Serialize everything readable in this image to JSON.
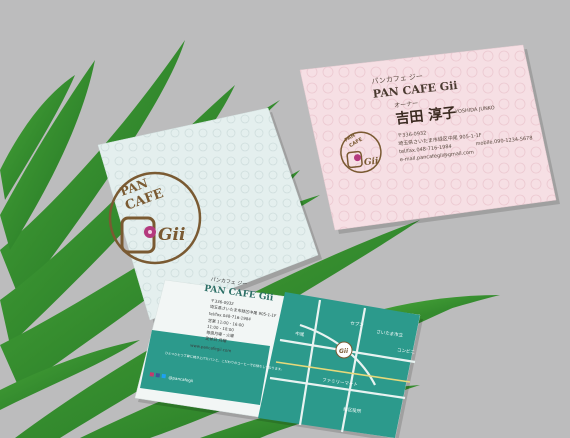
{
  "colors": {
    "background": "#bcbcbd",
    "leaf": "#2e8a2a",
    "card_mint": "#e4efee",
    "card_pink": "#f6dfe4",
    "teal": "#2c9a8c",
    "logo_brown": "#7a5a32",
    "flower": "#b43a7e"
  },
  "logo": {
    "line1": "PAN",
    "line2": "CAFE",
    "line3": "Gii"
  },
  "pink_card": {
    "kana": "パンカフェ ジー",
    "shop_name": "PAN CAFE Gii",
    "role": "オーナー",
    "person_name": "吉田 淳子",
    "person_romaji": "YOSHIDA JUNKO",
    "address_1": "〒336-0932",
    "address_2": "埼玉県さいたま市緑区中尾 905-1-1F",
    "tel": "tel/fax.048-716-1984",
    "mobile": "mobile.090-1234-5678",
    "email": "e-mail.pancafegii@gmail.com"
  },
  "back_card": {
    "kana": "パンカフェ ジー",
    "shop_name": "PAN CAFE Gii",
    "address_1": "〒336-0932",
    "address_2": "埼玉県さいたま市緑区中尾 905-1-1F",
    "tel": "tel/fax.048-716-1984",
    "hours_1": "営業 11:00 - 16:00",
    "hours_2": "定休日 月曜",
    "hours_3": "11:00 - 18:00",
    "closed": "毎週月曜・火曜",
    "url": "www.pancafegii.com",
    "sns": "@pancafegii",
    "intro": "ひとつひとつ丁寧に焼き上げたパンと、こだわりのコーヒーでお待ちしております。",
    "map_label_1": "さいたま市立",
    "map_label_2": "セブン",
    "map_label_3": "コンビニ",
    "map_label_4": "ファミリーマート",
    "map_label_5": "中尾",
    "map_label_6": "緑区役所"
  }
}
